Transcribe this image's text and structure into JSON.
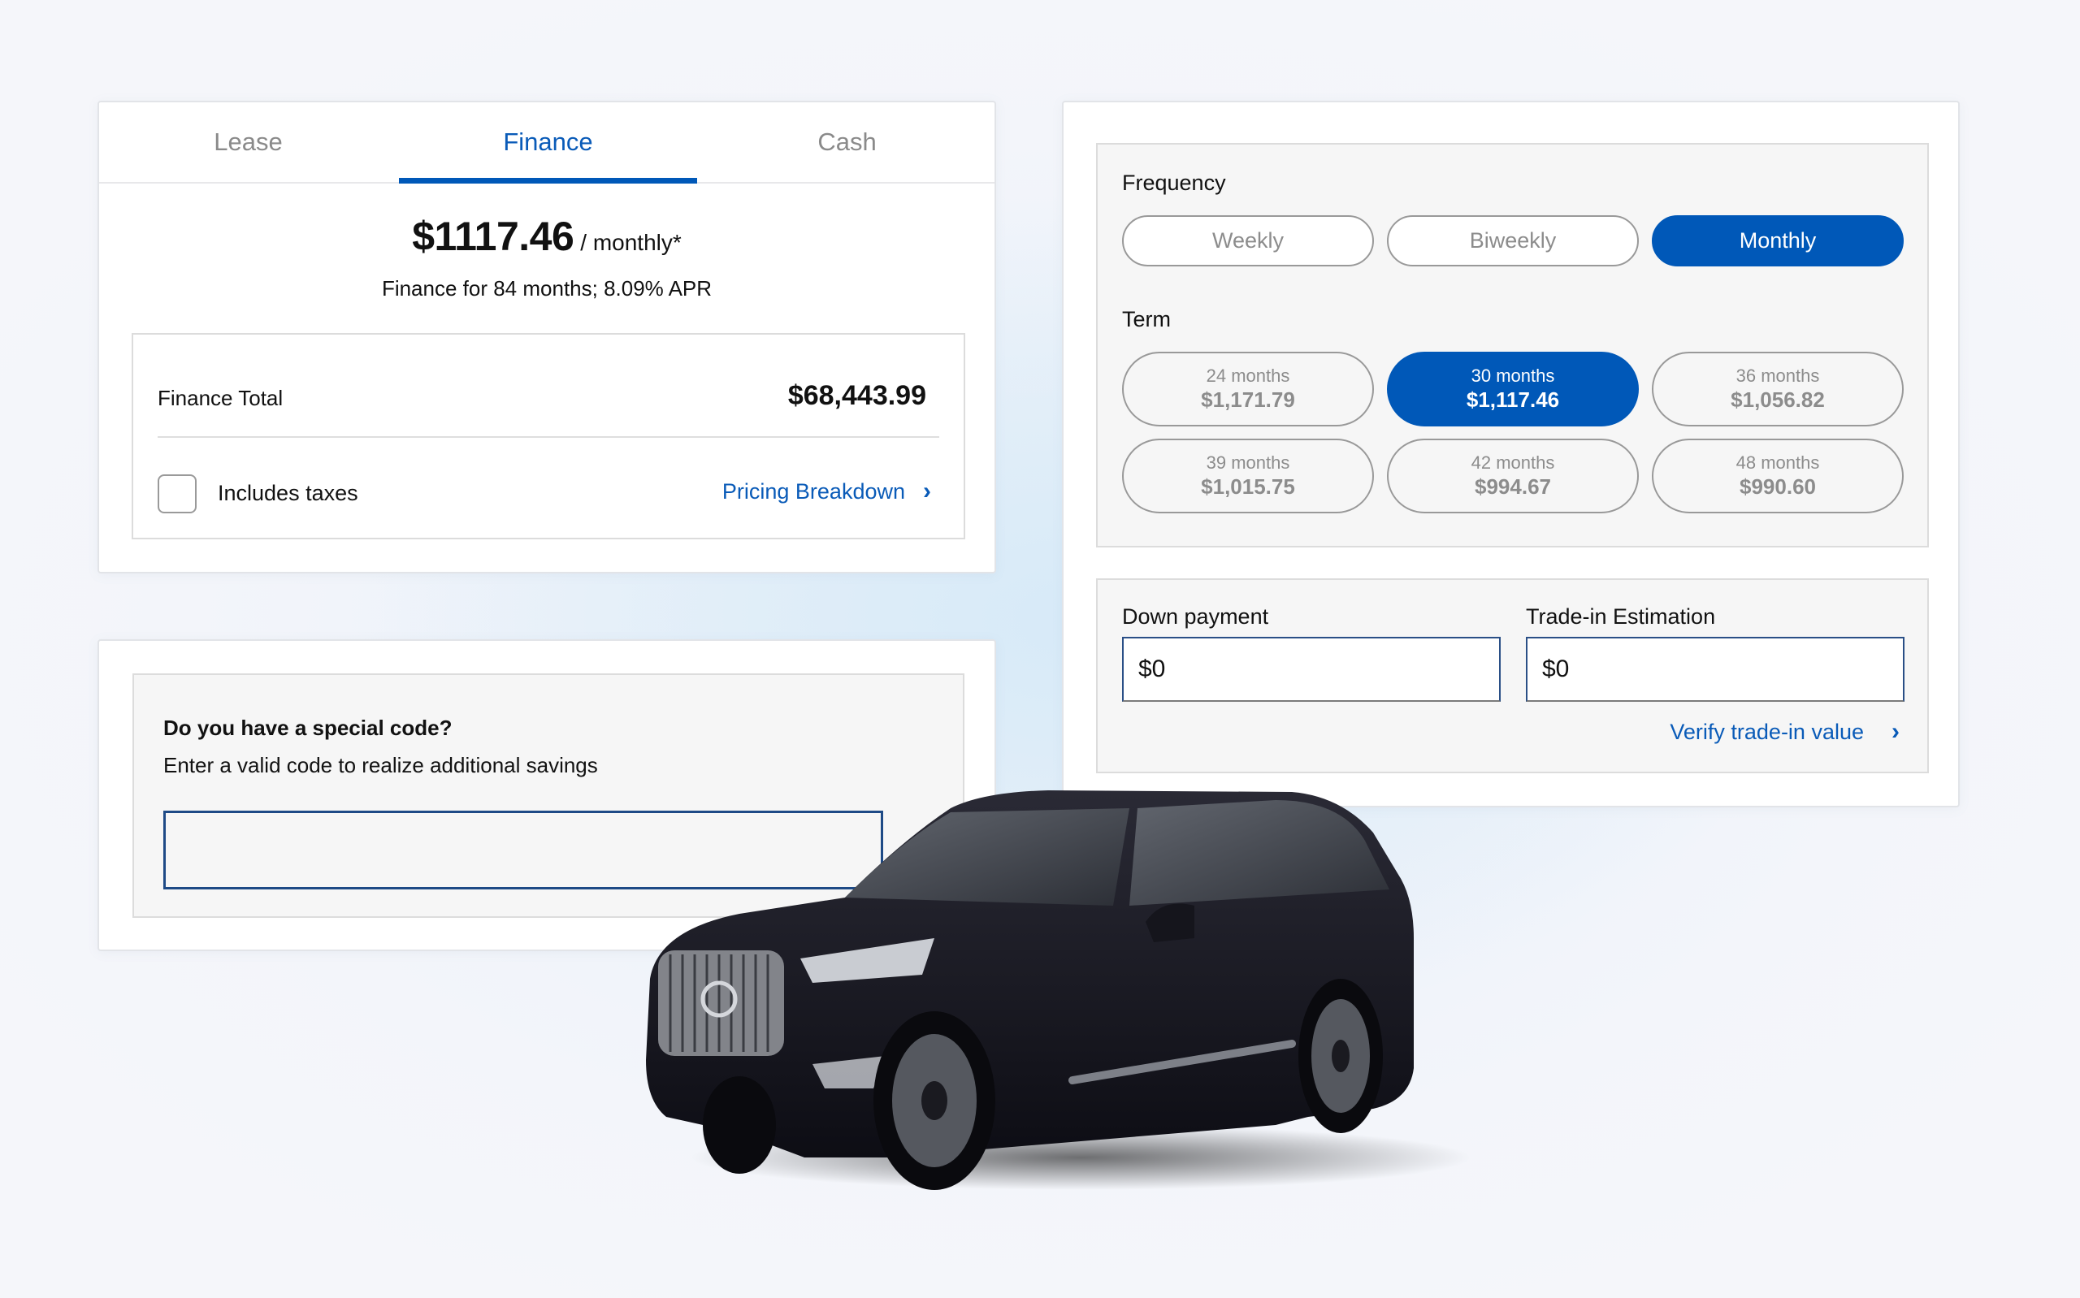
{
  "finance_panel": {
    "tabs": [
      {
        "label": "Lease",
        "active": false
      },
      {
        "label": "Finance",
        "active": true
      },
      {
        "label": "Cash",
        "active": false
      }
    ],
    "monthly_price": "$1117.46",
    "price_unit": "/ monthly*",
    "finance_summary": "Finance for 84 months; 8.09% APR",
    "total_label": "Finance Total",
    "total_value": "$68,443.99",
    "includes_taxes_label": "Includes taxes",
    "includes_taxes_checked": false,
    "pricing_breakdown_label": "Pricing Breakdown"
  },
  "code_panel": {
    "title": "Do you have a special code?",
    "subtitle": "Enter a valid code to realize additional savings",
    "input_value": ""
  },
  "options_panel": {
    "frequency_label": "Frequency",
    "frequency_options": [
      {
        "label": "Weekly",
        "active": false
      },
      {
        "label": "Biweekly",
        "active": false
      },
      {
        "label": "Monthly",
        "active": true
      }
    ],
    "term_label": "Term",
    "term_options": [
      {
        "months": "24 months",
        "amount": "$1,171.79",
        "active": false
      },
      {
        "months": "30 months",
        "amount": "$1,117.46",
        "active": true
      },
      {
        "months": "36 months",
        "amount": "$1,056.82",
        "active": false
      },
      {
        "months": "39 months",
        "amount": "$1,015.75",
        "active": false
      },
      {
        "months": "42 months",
        "amount": "$994.67",
        "active": false
      },
      {
        "months": "48 months",
        "amount": "$990.60",
        "active": false
      }
    ],
    "down_payment_label": "Down payment",
    "down_payment_value": "$0",
    "trade_in_label": "Trade-in Estimation",
    "trade_in_value": "$0",
    "verify_link_label": "Verify trade-in value"
  },
  "colors": {
    "accent": "#0058b8",
    "link": "#0a5bb8",
    "input_border": "#1e4a86"
  },
  "image": {
    "subject": "black SUV",
    "icon": "car-image"
  }
}
